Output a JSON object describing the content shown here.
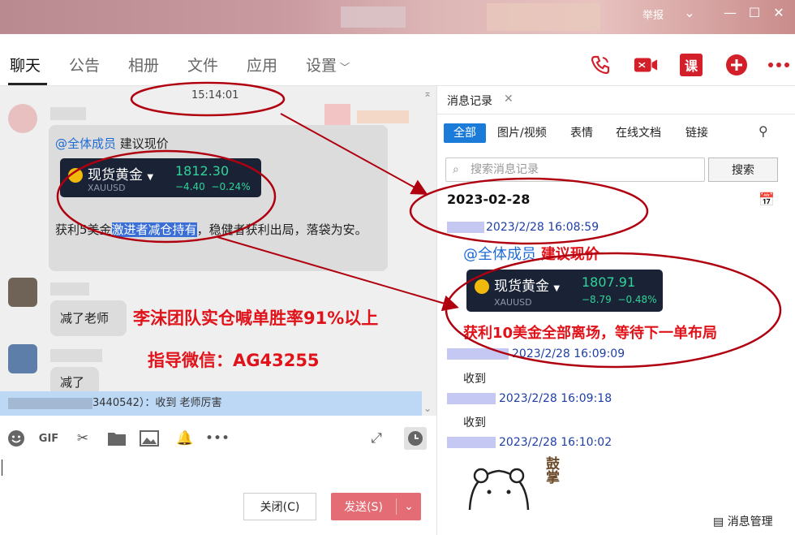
{
  "titlebar": {
    "report": "举报"
  },
  "tabs": [
    {
      "label": "聊天"
    },
    {
      "label": "公告"
    },
    {
      "label": "相册"
    },
    {
      "label": "文件"
    },
    {
      "label": "应用"
    },
    {
      "label": "设置"
    }
  ],
  "header_buttons": {
    "course": "课"
  },
  "chat": {
    "time": "15:14:01",
    "msg1": {
      "mention": "@全体成员",
      "text": " 建议现价",
      "card": {
        "name": "现货黄金",
        "symbol": "XAUUSD",
        "price": "1812.30",
        "change": "−4.40",
        "pct": "−0.24%"
      },
      "body_a": "获利5美金",
      "body_hl": "激进者减仓持有",
      "body_b": "，稳健者获利出局，落袋为安。"
    },
    "msg2": {
      "text": "减了老师"
    },
    "msg3": {
      "text": "减了"
    },
    "overlay1": "李沫团队实仓喊单胜率91%以上",
    "overlay2": "指导微信：AG43255",
    "notice": "3440542）：收到 老师厉害"
  },
  "input_area": {
    "close_label": "关闭(C)",
    "send_label": "发送(S)"
  },
  "panel": {
    "tab_label": "消息记录",
    "filters": [
      "全部",
      "图片/视频",
      "表情",
      "在线文档",
      "链接"
    ],
    "search_placeholder": "搜索消息记录",
    "search_button": "搜索",
    "date": "2023-02-28",
    "rec1": {
      "time": "2023/2/28 16:08:59",
      "mention": "@全体成员",
      "title": "建议现价",
      "card": {
        "name": "现货黄金",
        "symbol": "XAUUSD",
        "price": "1807.91",
        "change": "−8.79",
        "pct": "−0.48%"
      },
      "body": "获利10美金全部离场，等待下一单布局"
    },
    "rec2": {
      "time": "2023/2/28 16:09:09",
      "text": "收到"
    },
    "rec3": {
      "time": "2023/2/28 16:09:18",
      "text": "收到"
    },
    "rec4": {
      "time": "2023/2/28 16:10:02"
    },
    "sticker_text": "鼓掌",
    "bottom_link": "消息管理"
  },
  "colors": {
    "accent": "#1a7bd8",
    "send": "#e46d75",
    "annotation": "#b00010"
  }
}
